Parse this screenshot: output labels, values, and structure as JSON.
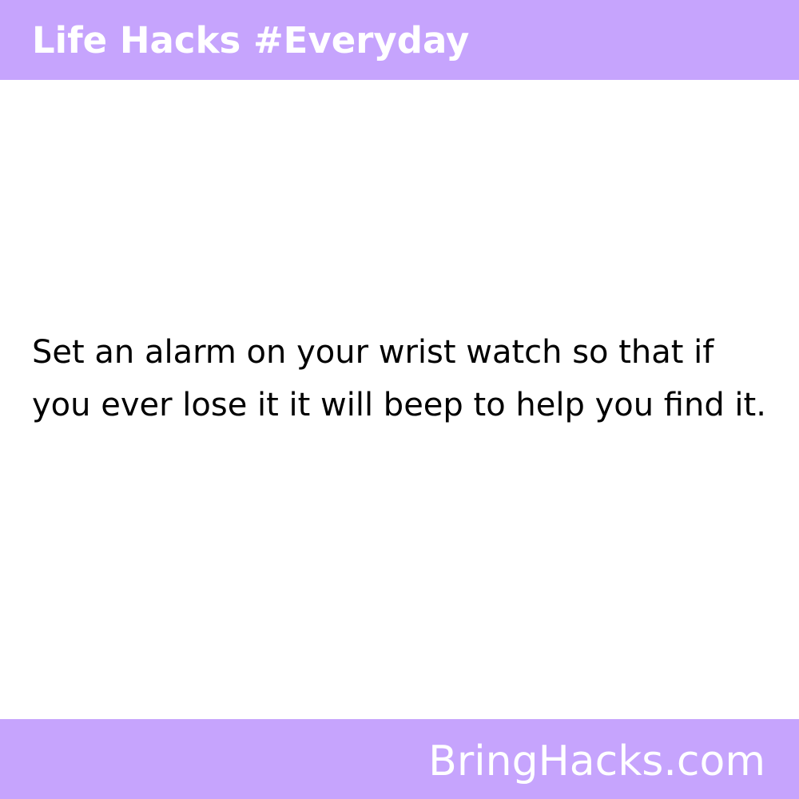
{
  "header": {
    "title": "Life Hacks #Everyday"
  },
  "tip": {
    "text": "Set an alarm on your wrist watch so that if you ever lose it it will beep to help you find it."
  },
  "footer": {
    "site": "BringHacks.com"
  },
  "colors": {
    "banner": "#c6a4fd",
    "banner_text": "#ffffff",
    "body_text": "#000000",
    "background": "#ffffff"
  }
}
